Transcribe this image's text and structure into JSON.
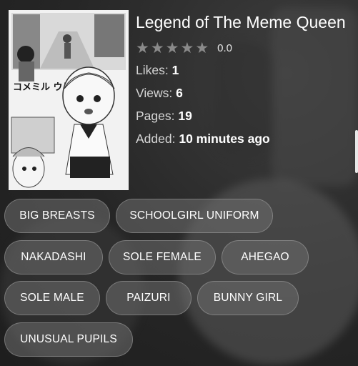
{
  "book": {
    "title": "Legend of The Meme Queen",
    "rating": "0.0",
    "stars": 5,
    "likes_label": "Likes:",
    "likes": "1",
    "views_label": "Views:",
    "views": "6",
    "pages_label": "Pages:",
    "pages": "19",
    "added_label": "Added:",
    "added": "10 minutes ago"
  },
  "tags": [
    "BIG BREASTS",
    "SCHOOLGIRL UNIFORM",
    "NAKADASHI",
    "SOLE FEMALE",
    "AHEGAO",
    "SOLE MALE",
    "PAIZURI",
    "BUNNY GIRL",
    "UNUSUAL PUPILS"
  ],
  "cover": {
    "title_text": "コメミル ウヒット"
  },
  "icons": {
    "star": "star-icon"
  }
}
